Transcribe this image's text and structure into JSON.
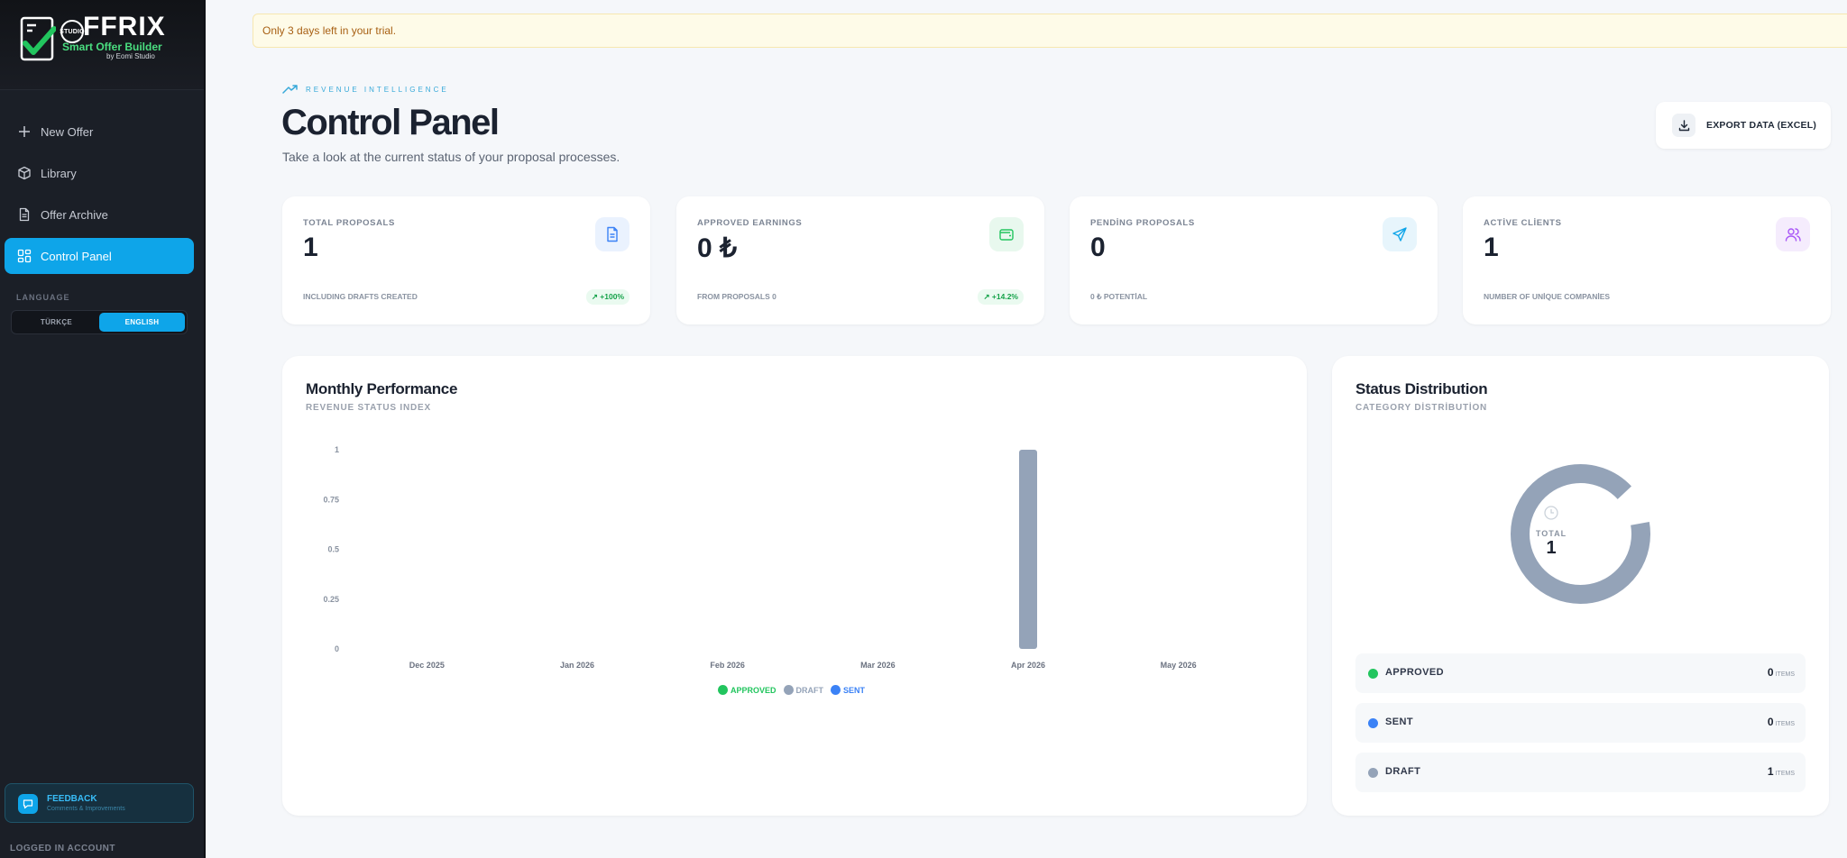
{
  "sidebar": {
    "logo": {
      "word": "FFRIX",
      "studio": "STUDIO",
      "subtitle": "Smart Offer Builder",
      "by": "by Eomi Studio"
    },
    "nav": [
      {
        "label": "New Offer",
        "icon": "plus-icon"
      },
      {
        "label": "Library",
        "icon": "box-icon"
      },
      {
        "label": "Offer Archive",
        "icon": "file-icon"
      },
      {
        "label": "Control Panel",
        "icon": "grid-icon",
        "active": true
      }
    ],
    "language_title": "LANGUAGE",
    "languages": [
      "TÜRKÇE",
      "ENGLISH"
    ],
    "feedback": {
      "title": "FEEDBACK",
      "subtitle": "Comments & Improvements"
    },
    "logged_in": "LOGGED IN ACCOUNT"
  },
  "trial_banner": "Only 3 days left in your trial.",
  "header": {
    "eyebrow": "REVENUE INTELLIGENCE",
    "title": "Control Panel",
    "subtitle": "Take a look at the current status of your proposal processes.",
    "export_label": "EXPORT DATA (EXCEL)"
  },
  "stats": [
    {
      "label": "TOTAL PROPOSALS",
      "value": "1",
      "foot": "INCLUDING DRAFTS CREATED",
      "badge": "↗ +100%",
      "icon": "document-icon",
      "color": "#3b82f6"
    },
    {
      "label": "APPROVED EARNINGS",
      "value": "0 ₺",
      "foot": "FROM PROPOSALS 0",
      "badge": "↗ +14.2%",
      "icon": "wallet-icon",
      "color": "#22c55e"
    },
    {
      "label": "PENDİNG PROPOSALS",
      "value": "0",
      "foot": "0 ₺ POTENTİAL",
      "badge": "",
      "icon": "send-icon",
      "color": "#0ea5e9"
    },
    {
      "label": "ACTİVE CLİENTS",
      "value": "1",
      "foot": "NUMBER OF UNİQUE COMPANİES",
      "badge": "",
      "icon": "users-icon",
      "color": "#a855f7"
    }
  ],
  "monthly": {
    "title": "Monthly Performance",
    "subtitle": "REVENUE STATUS INDEX"
  },
  "status": {
    "title": "Status Distribution",
    "subtitle": "CATEGORY DİSTRİBUTİON",
    "total_label": "TOTAL",
    "total": "1",
    "unit": "ITEMS",
    "rows": [
      {
        "label": "APPROVED",
        "count": "0",
        "color": "#22c55e"
      },
      {
        "label": "SENT",
        "count": "0",
        "color": "#3b82f6"
      },
      {
        "label": "DRAFT",
        "count": "1",
        "color": "#94a3b8"
      }
    ]
  },
  "chart_data": {
    "type": "bar",
    "categories": [
      "Dec 2025",
      "Jan 2026",
      "Feb 2026",
      "Mar 2026",
      "Apr 2026",
      "May 2026"
    ],
    "series": [
      {
        "name": "APPROVED",
        "color": "#22c55e",
        "values": [
          0,
          0,
          0,
          0,
          0,
          0
        ]
      },
      {
        "name": "DRAFT",
        "color": "#94a3b8",
        "values": [
          0,
          0,
          0,
          0,
          1,
          0
        ]
      },
      {
        "name": "SENT",
        "color": "#3b82f6",
        "values": [
          0,
          0,
          0,
          0,
          0,
          0
        ]
      }
    ],
    "yticks": [
      "0",
      "0.25",
      "0.5",
      "0.75",
      "1"
    ],
    "ylim": [
      0,
      1
    ],
    "legend": "bottom-center"
  }
}
